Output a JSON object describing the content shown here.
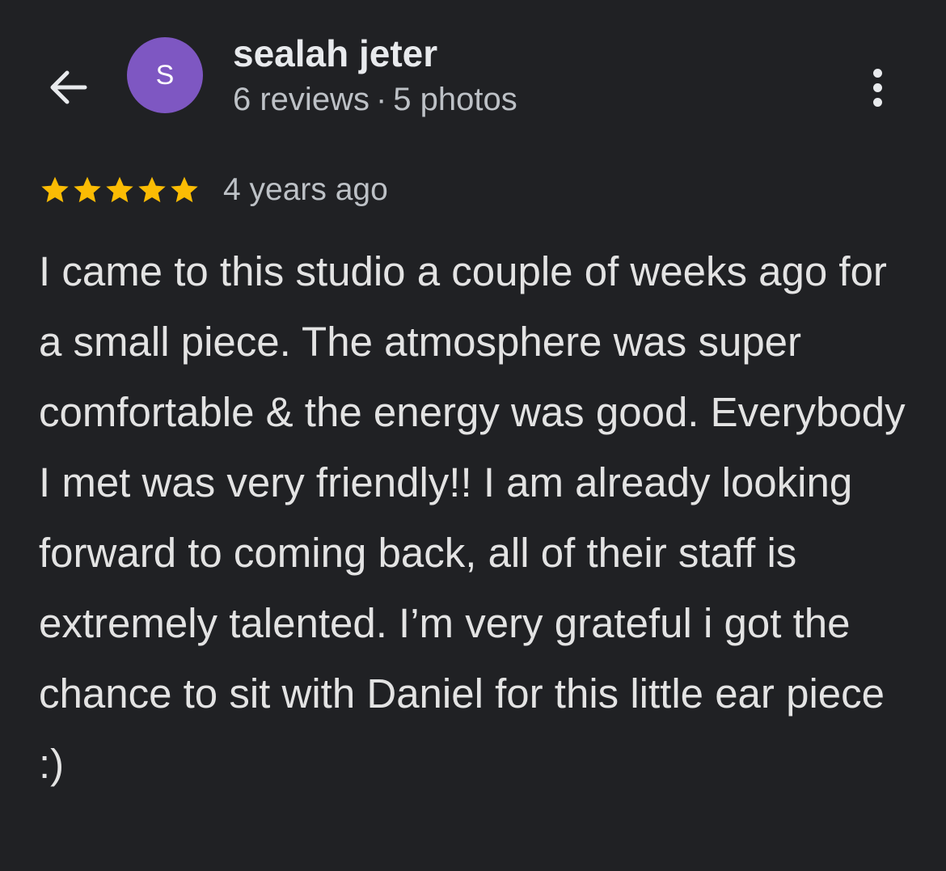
{
  "header": {
    "back_icon": "arrow-back-icon",
    "avatar_letter": "S",
    "avatar_color": "#7e57c2",
    "user_name": "sealah jeter",
    "reviews_count": "6 reviews",
    "separator": "·",
    "photos_count": "5 photos",
    "more_icon": "more-vert-icon"
  },
  "review": {
    "rating": 5,
    "rating_max": 5,
    "star_color": "#fbbc04",
    "time_ago": "4 years ago",
    "text": "I came to this studio a couple of weeks ago for a small piece. The atmosphere was super comfortable & the energy was good. Everybody I met was very friendly!! I am already looking forward to coming back, all of their staff is extremely talented. I’m very grateful i got the chance to sit with Daniel for this little ear piece :)"
  }
}
